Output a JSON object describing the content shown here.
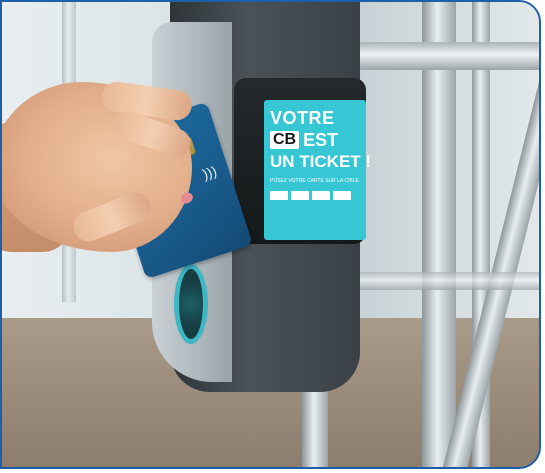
{
  "sign": {
    "line1": "VOTRE",
    "cb": "CB",
    "est": "EST",
    "line3": "UN TICKET !",
    "small_text": "POSEZ VOTRE CARTE SUR LA CIBLE"
  },
  "colors": {
    "sign_background": "#37c6d4",
    "frame_border": "#1f5ea8",
    "card": "#1a5d8f",
    "validator": "#3a4146"
  }
}
